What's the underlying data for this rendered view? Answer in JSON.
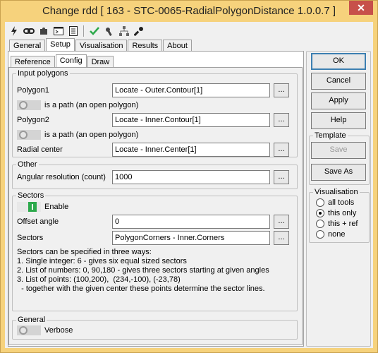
{
  "window": {
    "title": "Change rdd [ 163 - STC-0065-RadialPolygonDistance 1.0.0.7 ]",
    "close_label": "✕"
  },
  "toolbar": {
    "icons": [
      "lightning-icon",
      "link-icon",
      "puzzle-icon",
      "terminal-icon",
      "list-icon",
      "check-icon",
      "tools-icon",
      "hierarchy-icon",
      "wrench-icon"
    ]
  },
  "tabs_top": [
    "General",
    "Setup",
    "Visualisation",
    "Results",
    "About"
  ],
  "tabs_sub": [
    "Reference",
    "Config",
    "Draw"
  ],
  "input_polygons": {
    "title": "Input polygons",
    "polygon1_label": "Polygon1",
    "polygon1_value": "Locate - Outer.Contour[1]",
    "path1_label": "is a path (an open polygon)",
    "polygon2_label": "Polygon2",
    "polygon2_value": "Locate - Inner.Contour[1]",
    "path2_label": "is a path (an open polygon)",
    "radial_label": "Radial center",
    "radial_value": "Locate - Inner.Center[1]",
    "dots": "..."
  },
  "other": {
    "title": "Other",
    "angular_label": "Angular resolution (count)",
    "angular_value": "1000"
  },
  "sectors": {
    "title": "Sectors",
    "enable_label": "Enable",
    "offset_label": "Offset angle",
    "offset_value": "0",
    "sectors_label": "Sectors",
    "sectors_value": "PolygonCorners - Inner.Corners",
    "help": "Sectors can be specified in three ways:\n1. Single integer: 6 - gives six equal sized sectors\n2. List of numbers: 0, 90,180 - gives three sectors starting at given angles\n3. List of points: (100,200),  (234,-100), (-23,78)\n  - together with the given center these points determine the sector lines."
  },
  "general": {
    "title": "General",
    "verbose_label": "Verbose"
  },
  "right": {
    "ok": "OK",
    "cancel": "Cancel",
    "apply": "Apply",
    "help": "Help",
    "template_title": "Template",
    "save": "Save",
    "save_as": "Save As",
    "visualisation_title": "Visualisation",
    "options": [
      "all tools",
      "this only",
      "this + ref",
      "none"
    ],
    "selected": "this only"
  }
}
